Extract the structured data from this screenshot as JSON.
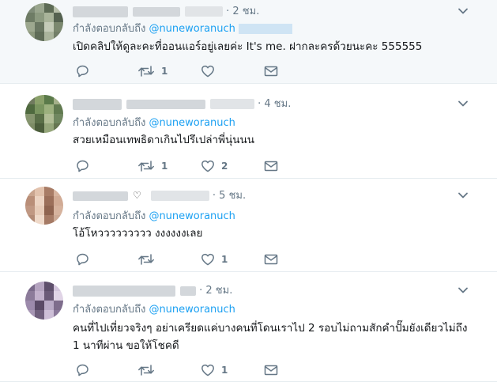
{
  "tweets": [
    {
      "time": "· 2 ชม.",
      "reply_label": "กำลังตอบกลับถึง",
      "reply_handle": "@nuneworanuch",
      "text": "เปิดคลิปให้ดูละคะที่ออนแอร์อยู่เลยค่ะ It's me. ฝากละครด้วยนะคะ 555555",
      "reply_count": "",
      "retweet_count": "1",
      "like_count": "",
      "avatar_colors": [
        "#7f8c78",
        "#9aa68e",
        "#5d6b55",
        "#b7bfa9",
        "#6e7c65",
        "#8c9a80",
        "#a9b49a",
        "#556250",
        "#9da88f",
        "#6a7762",
        "#c4cbb8",
        "#7b886f",
        "#8b977c",
        "#5f6c57",
        "#aab49c",
        "#737f69"
      ]
    },
    {
      "time": "· 4 ชม.",
      "reply_label": "กำลังตอบกลับถึง",
      "reply_handle": "@nuneworanuch",
      "text": "สวยเหมือนเทพธิดาเกินไปรึเปล่าพี่นุ่นนน",
      "reply_count": "",
      "retweet_count": "1",
      "like_count": "2",
      "avatar_colors": [
        "#6f7a5e",
        "#8aa06a",
        "#5b7a4a",
        "#a4b08a",
        "#4f6a3f",
        "#7a9560",
        "#9cb07e",
        "#617a50",
        "#86956f",
        "#5a6f48",
        "#b0bc95",
        "#708760",
        "#7d8c66",
        "#4c5e3c",
        "#95a67b",
        "#667652"
      ]
    },
    {
      "time": "· 5 ชม.",
      "reply_label": "กำลังตอบกลับถึง",
      "reply_handle": "@nuneworanuch",
      "text": "โอ้โหววววววววว งงงงงงเลย",
      "reply_count": "",
      "retweet_count": "",
      "like_count": "1",
      "avatar_colors": [
        "#c9a48e",
        "#e2c2ad",
        "#a87c66",
        "#d8b5a0",
        "#b98e78",
        "#ecd3c2",
        "#9b6f5a",
        "#d1ab95",
        "#c09883",
        "#e7cbb8",
        "#8f6450",
        "#d6b39e",
        "#b38b76",
        "#efd9c9",
        "#a57a65",
        "#ccaa96"
      ]
    },
    {
      "time": "· 2 ชม.",
      "reply_label": "กำลังตอบกลับถึง",
      "reply_handle": "@nuneworanuch",
      "text": "คนที่ไปเที่ยวจริงๆ อย่าเครียดแค่บางคนที่โดนเราไป 2 รอบไม่ถามสักคำปั๊มยังเดียวไม่ถึง 1 นาทีผ่าน ขอให้โชคดี",
      "reply_count": "",
      "retweet_count": "",
      "like_count": "1",
      "avatar_colors": [
        "#7a6a8a",
        "#b5a4c0",
        "#5e4f6b",
        "#d3c5dc",
        "#8c7b9a",
        "#c2b1cc",
        "#6b5a78",
        "#e0d4e6",
        "#9c8aab",
        "#5a4a66",
        "#b9aac6",
        "#7e6d8c",
        "#a796b4",
        "#6f5f7c",
        "#cdbfd7",
        "#8a799a"
      ]
    }
  ]
}
